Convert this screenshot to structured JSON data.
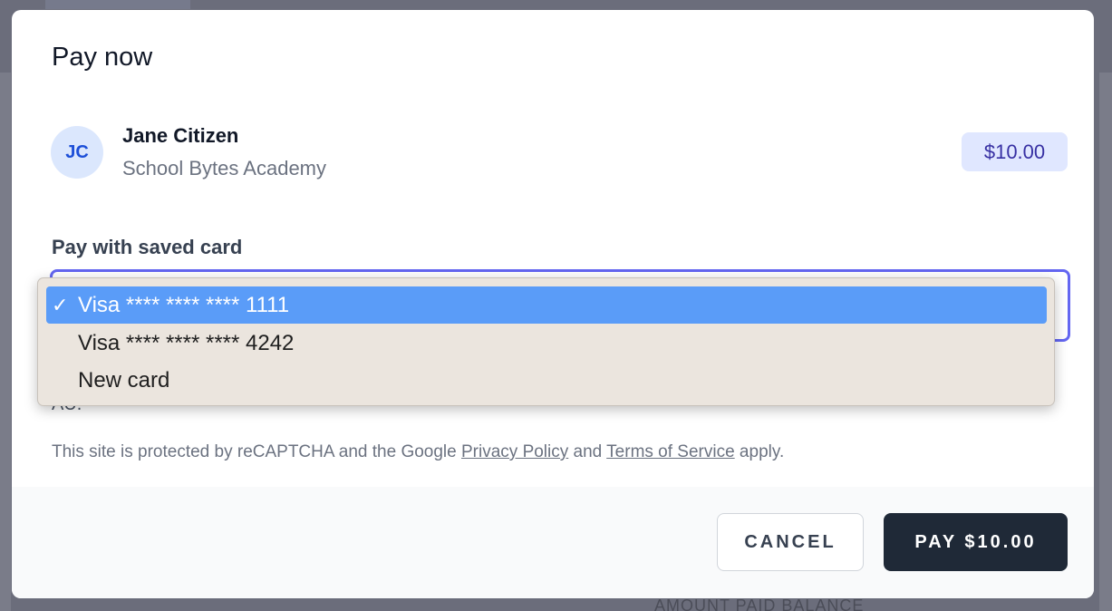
{
  "background": {
    "footer_hint": "AMOUNT   PAID   BALANCE"
  },
  "modal": {
    "title": "Pay now",
    "payer": {
      "initials": "JC",
      "name": "Jane Citizen",
      "school": "School Bytes Academy"
    },
    "amount": "$10.00",
    "field_label": "Pay with saved card",
    "hidden_text": "AU.",
    "recaptcha": {
      "prefix": "This site is protected by reCAPTCHA and the Google ",
      "privacy_link": "Privacy Policy",
      "middle": " and ",
      "terms_link": "Terms of Service",
      "suffix": " apply."
    },
    "buttons": {
      "cancel": "CANCEL",
      "pay": "PAY $10.00"
    }
  },
  "dropdown": {
    "check_glyph": "✓",
    "options": [
      {
        "label": "Visa **** **** **** 1111",
        "selected": true
      },
      {
        "label": "Visa **** **** **** 4242",
        "selected": false
      },
      {
        "label": "New card",
        "selected": false
      }
    ]
  },
  "colors": {
    "accent": "#6366f1",
    "selected_option": "#5a9cf8",
    "primary_button": "#1f2937",
    "badge_bg": "#e0e7ff"
  }
}
